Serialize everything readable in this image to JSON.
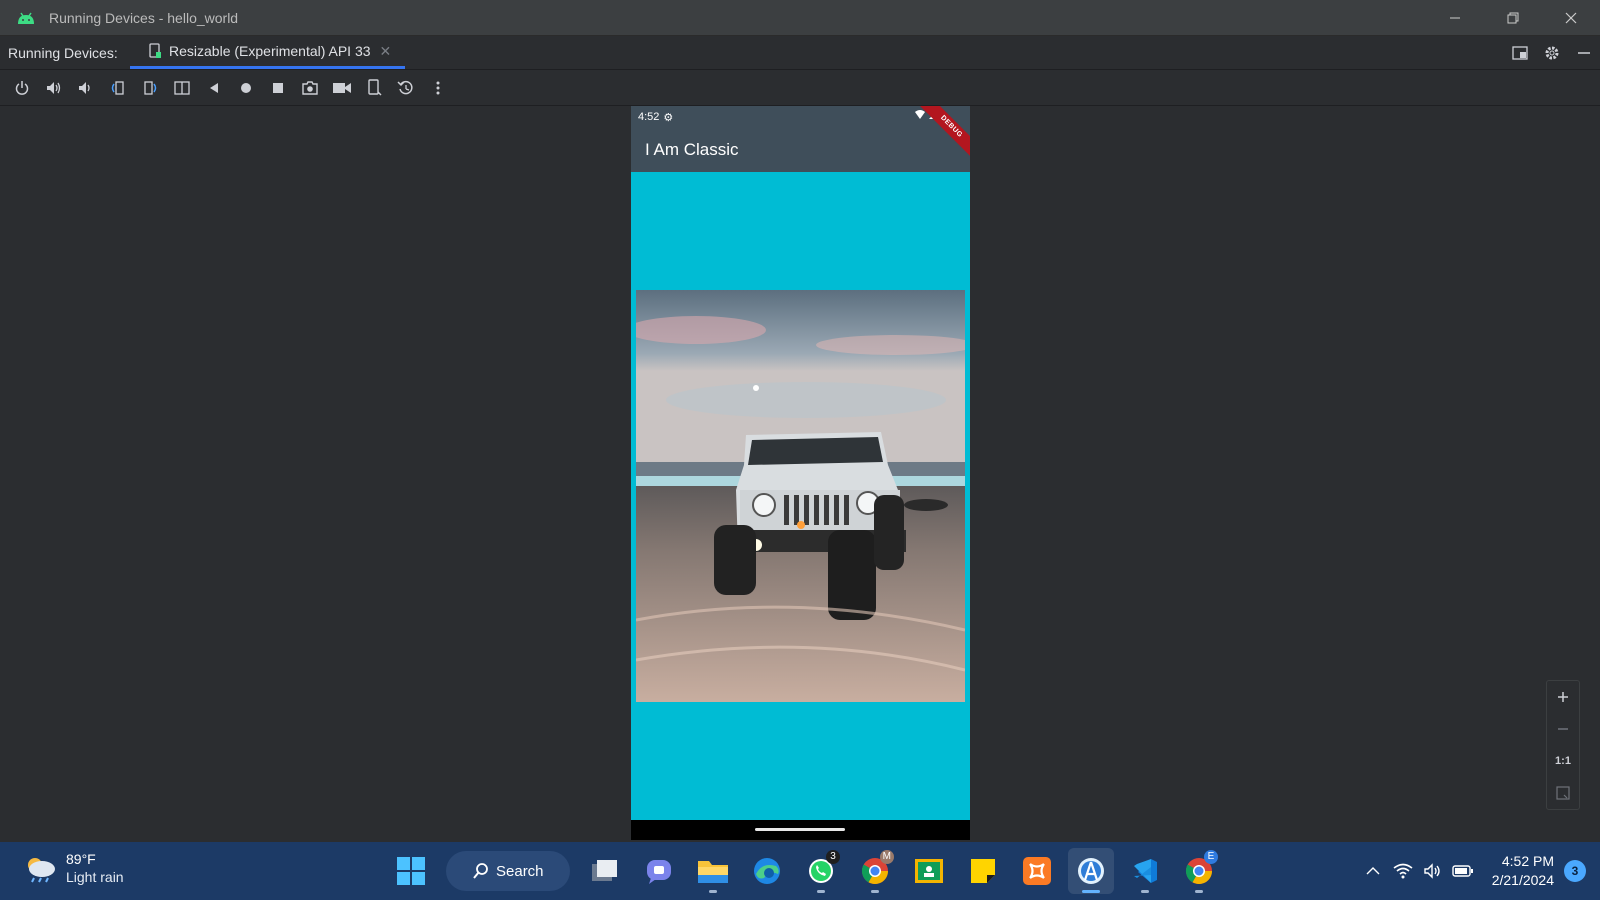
{
  "window": {
    "title": "Running Devices - hello_world"
  },
  "tabs": {
    "label": "Running Devices:",
    "active_tab": "Resizable (Experimental) API 33"
  },
  "toolbar": {
    "buttons": [
      "power-icon",
      "volume-up-icon",
      "volume-down-icon",
      "rotate-left-icon",
      "rotate-right-icon",
      "fold-icon",
      "back-icon",
      "home-icon",
      "overview-icon",
      "screenshot-icon",
      "screen-record-icon",
      "device-frame-icon",
      "reset-icon",
      "more-icon"
    ]
  },
  "device": {
    "status_time": "4:52",
    "app_title": "I Am Classic",
    "debug_banner": "DEBUG",
    "background_color": "#00bcd4"
  },
  "zoom": {
    "actual_size_label": "1:1"
  },
  "taskbar": {
    "weather_temp": "89°F",
    "weather_condition": "Light rain",
    "search_label": "Search",
    "whatsapp_badge": "3",
    "time": "4:52 PM",
    "date": "2/21/2024",
    "notification_count": "3"
  }
}
